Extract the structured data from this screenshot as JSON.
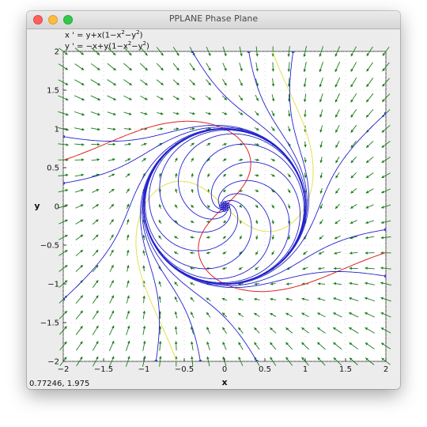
{
  "window": {
    "title": "PPLANE Phase Plane"
  },
  "equations": {
    "x_lhs": "x ' = ",
    "x_rhs_a": "y+x(1−x",
    "x_rhs_b": "−y",
    "x_rhs_c": ")",
    "y_lhs": "y ' = ",
    "y_rhs_a": "−x+y(1−x",
    "y_rhs_b": "−y",
    "y_rhs_c": ")",
    "exponent": "2"
  },
  "coordinate_readout": "0.77246,  1.975",
  "colors": {
    "plot_background": "#ffffff",
    "window_background": "#ececec",
    "vector_field": "#1a7a1a",
    "trajectory": "#2222cc",
    "x_nullcline": "#e0e050",
    "y_nullcline": "#dd2222",
    "grid_dots": "#bbbbbb"
  },
  "chart_data": {
    "type": "scatter",
    "title": "",
    "xlabel": "x",
    "ylabel": "y",
    "xlim": [
      -2,
      2
    ],
    "ylim": [
      -2,
      2
    ],
    "x_ticks": [
      -2,
      -1.5,
      -1,
      -0.5,
      0,
      0.5,
      1,
      1.5,
      2
    ],
    "y_ticks": [
      -2,
      -1.5,
      -1,
      -0.5,
      0,
      0.5,
      1,
      1.5,
      2
    ],
    "x_tick_labels": [
      "−2",
      "−1.5",
      "−1",
      "−0.5",
      "0",
      "0.5",
      "1",
      "1.5",
      "2"
    ],
    "y_tick_labels": [
      "−2",
      "−1.5",
      "−1",
      "−0.5",
      "0",
      "0.5",
      "1",
      "1.5",
      "2"
    ],
    "system": {
      "dx": "y + x(1 - x^2 - y^2)",
      "dy": "-x + y(1 - x^2 - y^2)"
    },
    "equilibrium": [
      0,
      0
    ],
    "limit_cycle_radius": 1,
    "vector_field_grid_step": 0.2,
    "trajectory_seeds": [
      [
        0.05,
        0
      ],
      [
        -0.05,
        0
      ],
      [
        0,
        0.05
      ],
      [
        0,
        -0.05
      ],
      [
        0.035,
        0.035
      ],
      [
        -0.035,
        -0.035
      ],
      [
        0.035,
        -0.035
      ],
      [
        -0.035,
        0.035
      ],
      [
        -2,
        0.9
      ],
      [
        -2,
        0.3
      ],
      [
        2,
        -0.9
      ],
      [
        2,
        -0.3
      ],
      [
        -0.4,
        2
      ],
      [
        0.3,
        2
      ],
      [
        0.85,
        2
      ],
      [
        0.4,
        -2
      ],
      [
        -0.3,
        -2
      ],
      [
        -0.85,
        -2
      ],
      [
        2,
        1.2
      ],
      [
        -2,
        -1.2
      ]
    ],
    "grid": true
  }
}
